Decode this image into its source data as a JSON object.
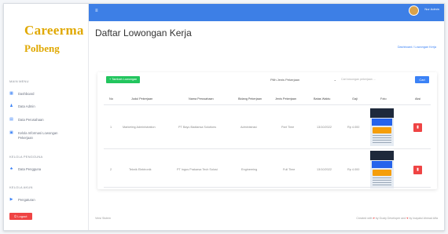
{
  "brand": {
    "line1": "Careerma",
    "line2": "Polbeng"
  },
  "sidebar": {
    "section_main": "MAIN MENU",
    "items": [
      {
        "label": "Dashboard",
        "icon": "dashboard-icon"
      },
      {
        "label": "Data Admin",
        "icon": "user-icon"
      },
      {
        "label": "Data Perusahaan",
        "icon": "building-icon"
      },
      {
        "label": "Kelola Informasi Lowongan Pekerjaan",
        "icon": "briefcase-icon"
      }
    ],
    "section_pengguna": "KELOLA PENGGUNA",
    "pengguna_items": [
      {
        "label": "Data Pengguna",
        "icon": "users-icon"
      }
    ],
    "section_akun": "KELOLA AKUN",
    "akun_items": [
      {
        "label": "Pengaturan",
        "icon": "settings-icon"
      }
    ],
    "logout_label": "Logout"
  },
  "topbar": {
    "menu_icon": "≡",
    "username": "Nur Admin"
  },
  "page": {
    "title": "Daftar Lowongan Kerja",
    "breadcrumb": "Dashboard  /  Lowongan Kerja"
  },
  "toolbar": {
    "add_label": "+ Tambah Lowongan",
    "filter_value": "Pilih Jenis Pekerjaan",
    "search_placeholder": "Cari lowongan pekerjaan ...",
    "search_label": "Cari"
  },
  "table": {
    "headers": [
      "No",
      "Judul Pekerjaan",
      "Nama Perusahaan",
      "Bidang Pekerjaan",
      "Jenis Pekerjaan",
      "Batas Waktu",
      "Gaji",
      "Foto",
      "Aksi"
    ],
    "rows": [
      [
        "1",
        "Marketing Administration",
        "PT Bayu Badiansa Solutions",
        "Administrasi",
        "Part Time",
        "13/10/2022",
        "Rp 4.000",
        "poster",
        "delete"
      ],
      [
        "2",
        "Teknik Elektronik",
        "PT Ingus Prakarsa Tech Solusi",
        "Engineering",
        "Full Time",
        "13/10/2022",
        "Rp 4.000",
        "poster",
        "delete"
      ]
    ]
  },
  "footer": {
    "left": "Versi Sistem",
    "right_prefix": "Created with",
    "right_mid": "by Gusty Developer and",
    "right_suffix": "by Inayatul Ahmad Alfa"
  },
  "colors": {
    "accent": "#3d7fe6",
    "brand": "#e0a800",
    "success": "#22c55e",
    "danger": "#ef4444"
  }
}
